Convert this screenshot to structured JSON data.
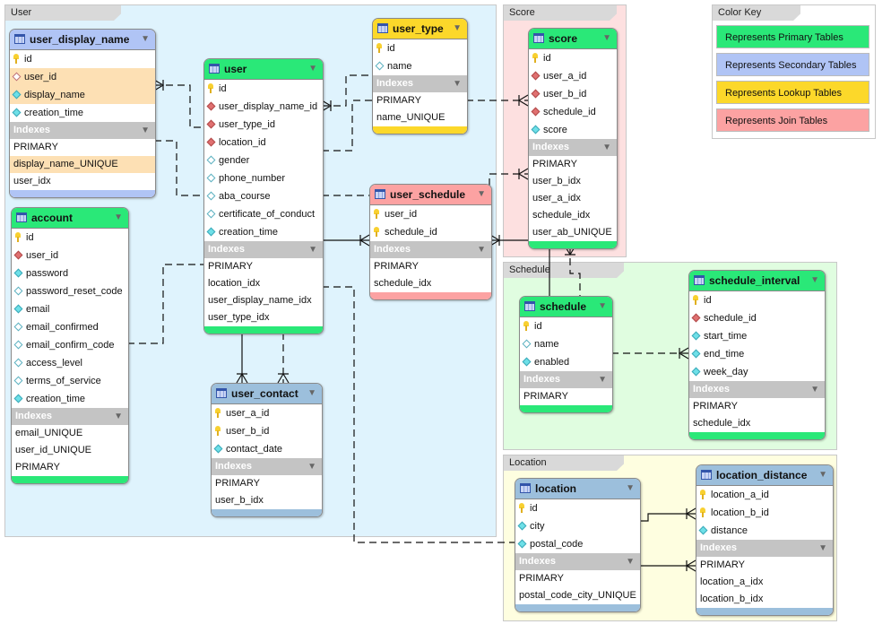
{
  "colors": {
    "primary": "#2ae878",
    "secondary": "#b0c4f5",
    "secondary_alt": "#9cbfdc",
    "lookup": "#fcd82a",
    "join": "#fca2a2",
    "highlight": "#fde0b4"
  },
  "regions": [
    {
      "id": "user",
      "label": "User",
      "color": "#dff3fd"
    },
    {
      "id": "score",
      "label": "Score",
      "color": "#fde0e0"
    },
    {
      "id": "schedule",
      "label": "Schedule",
      "color": "#e0fde0"
    },
    {
      "id": "location",
      "label": "Location",
      "color": "#fefee0"
    }
  ],
  "color_key": {
    "title": "Color Key",
    "items": [
      {
        "label": "Represents Primary Tables",
        "color": "#2ae878"
      },
      {
        "label": "Represents Secondary Tables",
        "color": "#b0c4f5"
      },
      {
        "label": "Represents Lookup Tables",
        "color": "#fcd82a"
      },
      {
        "label": "Represents Join Tables",
        "color": "#fca2a2"
      }
    ]
  },
  "indexes_label": "Indexes",
  "tables": [
    {
      "id": "user_display_name",
      "name": "user_display_name",
      "color": "#b0c4f5",
      "columns": [
        {
          "name": "id",
          "key": "primary-key-icon"
        },
        {
          "name": "user_id",
          "key": "nullable-foreign-key-icon",
          "highlight": true
        },
        {
          "name": "display_name",
          "key": "not-null-column-icon",
          "highlight": true
        },
        {
          "name": "creation_time",
          "key": "not-null-column-icon"
        }
      ],
      "indexes": [
        {
          "name": "PRIMARY"
        },
        {
          "name": "display_name_UNIQUE",
          "highlight": true
        },
        {
          "name": "user_idx"
        }
      ]
    },
    {
      "id": "user",
      "name": "user",
      "color": "#2ae878",
      "columns": [
        {
          "name": "id",
          "key": "primary-key-icon"
        },
        {
          "name": "user_display_name_id",
          "key": "foreign-key-icon"
        },
        {
          "name": "user_type_id",
          "key": "foreign-key-icon"
        },
        {
          "name": "location_id",
          "key": "foreign-key-icon"
        },
        {
          "name": "gender",
          "key": "nullable-column-icon"
        },
        {
          "name": "phone_number",
          "key": "nullable-column-icon"
        },
        {
          "name": "aba_course",
          "key": "nullable-column-icon"
        },
        {
          "name": "certificate_of_conduct",
          "key": "nullable-column-icon"
        },
        {
          "name": "creation_time",
          "key": "not-null-column-icon"
        }
      ],
      "indexes": [
        {
          "name": "PRIMARY"
        },
        {
          "name": "location_idx"
        },
        {
          "name": "user_display_name_idx"
        },
        {
          "name": "user_type_idx"
        }
      ]
    },
    {
      "id": "user_type",
      "name": "user_type",
      "color": "#fcd82a",
      "columns": [
        {
          "name": "id",
          "key": "primary-key-icon"
        },
        {
          "name": "name",
          "key": "nullable-column-icon"
        }
      ],
      "indexes": [
        {
          "name": "PRIMARY"
        },
        {
          "name": "name_UNIQUE"
        }
      ]
    },
    {
      "id": "score",
      "name": "score",
      "color": "#2ae878",
      "columns": [
        {
          "name": "id",
          "key": "primary-key-icon"
        },
        {
          "name": "user_a_id",
          "key": "foreign-key-icon"
        },
        {
          "name": "user_b_id",
          "key": "foreign-key-icon"
        },
        {
          "name": "schedule_id",
          "key": "foreign-key-icon"
        },
        {
          "name": "score",
          "key": "not-null-column-icon"
        }
      ],
      "indexes": [
        {
          "name": "PRIMARY"
        },
        {
          "name": "user_b_idx"
        },
        {
          "name": "user_a_idx"
        },
        {
          "name": "schedule_idx"
        },
        {
          "name": "user_ab_UNIQUE"
        }
      ]
    },
    {
      "id": "user_schedule",
      "name": "user_schedule",
      "color": "#fca2a2",
      "columns": [
        {
          "name": "user_id",
          "key": "primary-key-icon"
        },
        {
          "name": "schedule_id",
          "key": "primary-key-icon"
        }
      ],
      "indexes": [
        {
          "name": "PRIMARY"
        },
        {
          "name": "schedule_idx"
        }
      ]
    },
    {
      "id": "account",
      "name": "account",
      "color": "#2ae878",
      "columns": [
        {
          "name": "id",
          "key": "primary-key-icon"
        },
        {
          "name": "user_id",
          "key": "foreign-key-icon"
        },
        {
          "name": "password",
          "key": "not-null-column-icon"
        },
        {
          "name": "password_reset_code",
          "key": "nullable-column-icon"
        },
        {
          "name": "email",
          "key": "not-null-column-icon"
        },
        {
          "name": "email_confirmed",
          "key": "nullable-column-icon"
        },
        {
          "name": "email_confirm_code",
          "key": "nullable-column-icon"
        },
        {
          "name": "access_level",
          "key": "nullable-column-icon"
        },
        {
          "name": "terms_of_service",
          "key": "nullable-column-icon"
        },
        {
          "name": "creation_time",
          "key": "not-null-column-icon"
        }
      ],
      "indexes": [
        {
          "name": "email_UNIQUE"
        },
        {
          "name": "user_id_UNIQUE"
        },
        {
          "name": "PRIMARY"
        }
      ]
    },
    {
      "id": "user_contact",
      "name": "user_contact",
      "color": "#9cbfdc",
      "columns": [
        {
          "name": "user_a_id",
          "key": "primary-key-icon"
        },
        {
          "name": "user_b_id",
          "key": "primary-key-icon"
        },
        {
          "name": "contact_date",
          "key": "not-null-column-icon"
        }
      ],
      "indexes": [
        {
          "name": "PRIMARY"
        },
        {
          "name": "user_b_idx"
        }
      ]
    },
    {
      "id": "schedule",
      "name": "schedule",
      "color": "#2ae878",
      "columns": [
        {
          "name": "id",
          "key": "primary-key-icon"
        },
        {
          "name": "name",
          "key": "nullable-column-icon"
        },
        {
          "name": "enabled",
          "key": "not-null-column-icon"
        }
      ],
      "indexes": [
        {
          "name": "PRIMARY"
        }
      ]
    },
    {
      "id": "schedule_interval",
      "name": "schedule_interval",
      "color": "#2ae878",
      "columns": [
        {
          "name": "id",
          "key": "primary-key-icon"
        },
        {
          "name": "schedule_id",
          "key": "foreign-key-icon"
        },
        {
          "name": "start_time",
          "key": "not-null-column-icon"
        },
        {
          "name": "end_time",
          "key": "not-null-column-icon"
        },
        {
          "name": "week_day",
          "key": "not-null-column-icon"
        }
      ],
      "indexes": [
        {
          "name": "PRIMARY"
        },
        {
          "name": "schedule_idx"
        }
      ]
    },
    {
      "id": "location",
      "name": "location",
      "color": "#9cbfdc",
      "columns": [
        {
          "name": "id",
          "key": "primary-key-icon"
        },
        {
          "name": "city",
          "key": "not-null-column-icon"
        },
        {
          "name": "postal_code",
          "key": "not-null-column-icon"
        }
      ],
      "indexes": [
        {
          "name": "PRIMARY"
        },
        {
          "name": "postal_code_city_UNIQUE"
        }
      ]
    },
    {
      "id": "location_distance",
      "name": "location_distance",
      "color": "#9cbfdc",
      "columns": [
        {
          "name": "location_a_id",
          "key": "primary-key-icon"
        },
        {
          "name": "location_b_id",
          "key": "primary-key-icon"
        },
        {
          "name": "distance",
          "key": "not-null-column-icon"
        }
      ],
      "indexes": [
        {
          "name": "PRIMARY"
        },
        {
          "name": "location_a_idx"
        },
        {
          "name": "location_b_idx"
        }
      ]
    }
  ]
}
